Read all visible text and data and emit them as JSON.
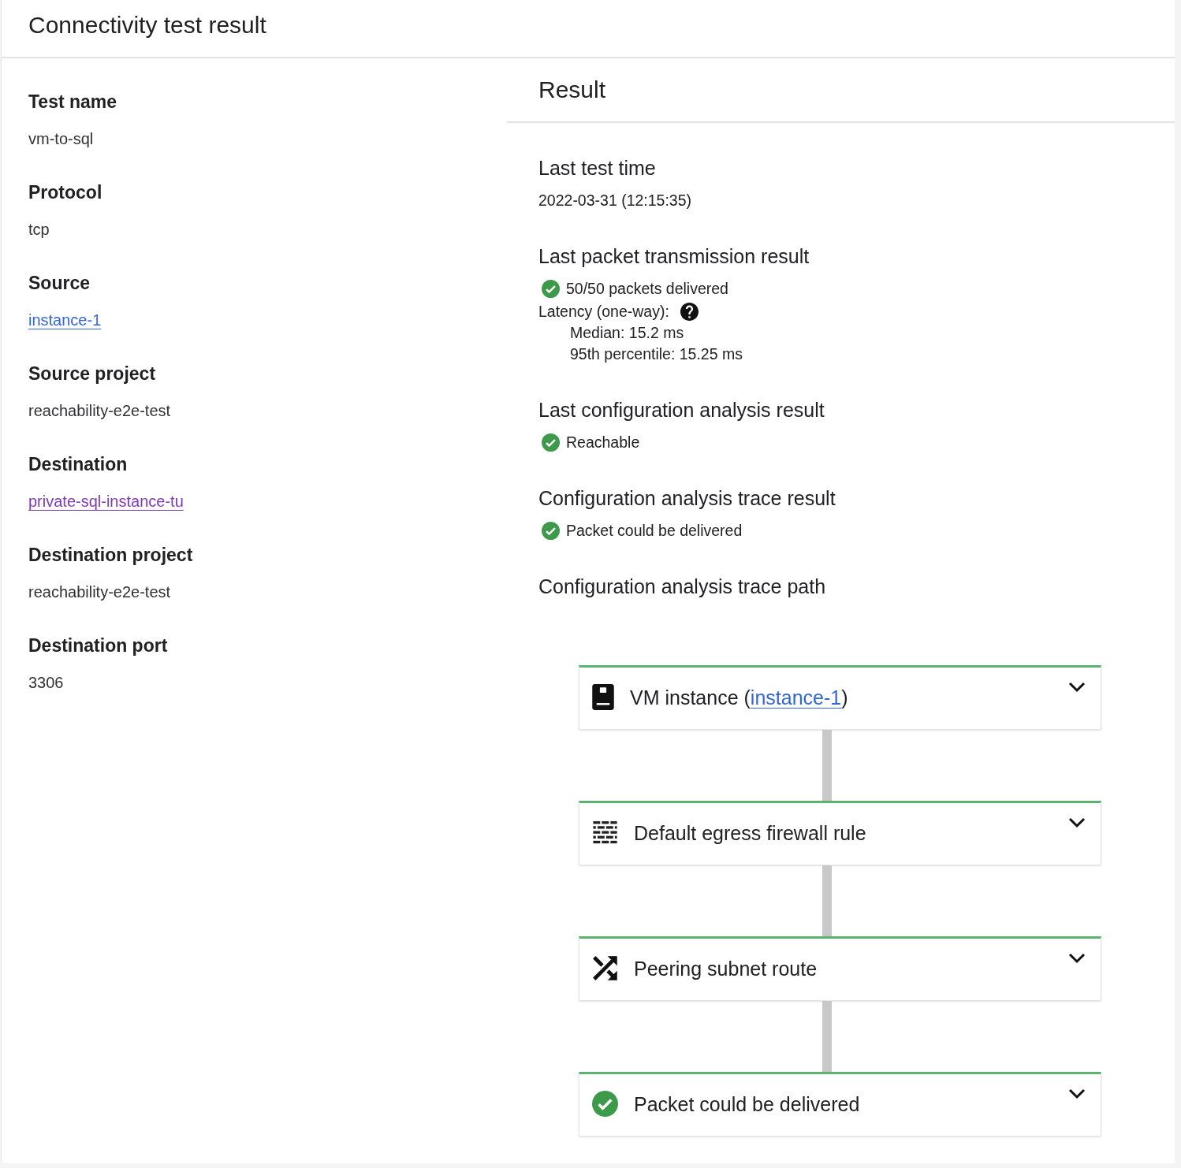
{
  "header": {
    "title": "Connectivity test result"
  },
  "details": [
    {
      "label": "Test name",
      "kind": "text",
      "value": "vm-to-sql"
    },
    {
      "label": "Protocol",
      "kind": "text",
      "value": "tcp"
    },
    {
      "label": "Source",
      "kind": "link",
      "value": "instance-1",
      "visited": false
    },
    {
      "label": "Source project",
      "kind": "text",
      "value": "reachability-e2e-test"
    },
    {
      "label": "Destination",
      "kind": "link",
      "value": "private-sql-instance-tu",
      "visited": true
    },
    {
      "label": "Destination project",
      "kind": "text",
      "value": "reachability-e2e-test"
    },
    {
      "label": "Destination port",
      "kind": "text",
      "value": "3306"
    }
  ],
  "result": {
    "title": "Result",
    "sections": [
      {
        "heading": "Last test time",
        "kind": "text",
        "value": "2022-03-31 (12:15:35)"
      },
      {
        "heading": "Last packet transmission result",
        "kind": "packets",
        "success": true,
        "value": "50/50 packets delivered",
        "latency": {
          "label": "Latency (one-way):",
          "lines": [
            "Median: 15.2 ms",
            "95th percentile: 15.25 ms"
          ]
        }
      },
      {
        "heading": "Last configuration analysis result",
        "kind": "status",
        "success": true,
        "value": "Reachable"
      },
      {
        "heading": "Configuration analysis trace result",
        "kind": "status",
        "success": true,
        "value": "Packet could be delivered"
      },
      {
        "heading": "Configuration analysis trace path",
        "kind": "trace",
        "steps": [
          {
            "kind": "vm",
            "parts": [
              {
                "text": "VM instance ("
              },
              {
                "text": "instance-1",
                "kind": "link",
                "visited": false
              },
              {
                "text": ")"
              }
            ],
            "expanded": false
          },
          {
            "kind": "firewall",
            "parts": [
              {
                "text": "Default egress firewall rule"
              }
            ],
            "expanded": false
          },
          {
            "kind": "route",
            "parts": [
              {
                "text": "Peering subnet route"
              }
            ],
            "expanded": false
          },
          {
            "kind": "delivered",
            "parts": [
              {
                "text": "Packet could be delivered"
              }
            ],
            "expanded": false
          }
        ]
      }
    ]
  }
}
